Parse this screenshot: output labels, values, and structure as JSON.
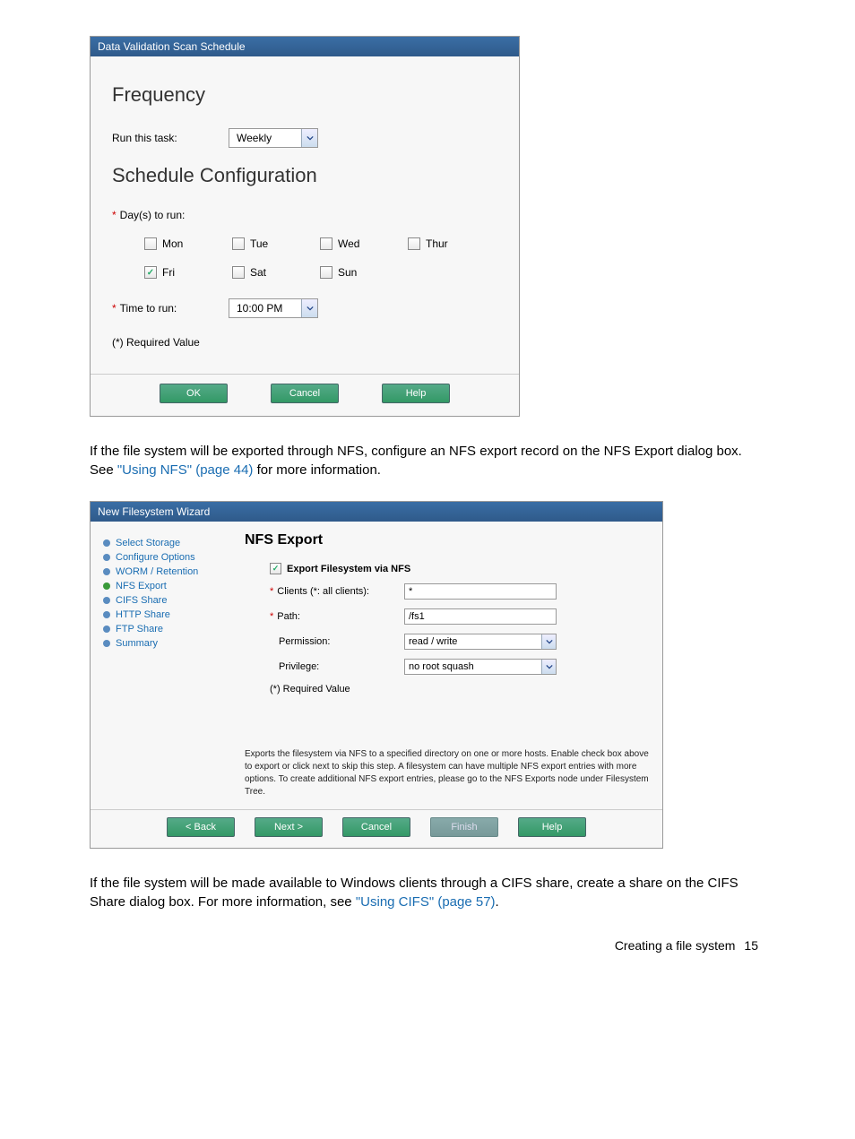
{
  "panel1": {
    "title": "Data Validation Scan Schedule",
    "section1": "Frequency",
    "task_label": "Run this task:",
    "task_value": "Weekly",
    "section2": "Schedule Configuration",
    "days_label": "Day(s) to run:",
    "days": {
      "mon": "Mon",
      "tue": "Tue",
      "wed": "Wed",
      "thur": "Thur",
      "fri": "Fri",
      "sat": "Sat",
      "sun": "Sun"
    },
    "time_label": "Time to run:",
    "time_value": "10:00 PM",
    "reqnote": "(*) Required Value",
    "buttons": {
      "ok": "OK",
      "cancel": "Cancel",
      "help": "Help"
    }
  },
  "p1": {
    "pre": "If the file system will be exported through NFS, configure an NFS export record on the NFS Export dialog box. See ",
    "link": "\"Using NFS\" (page 44)",
    "post": " for more information."
  },
  "panel2": {
    "title": "New Filesystem Wizard",
    "nav": [
      "Select Storage",
      "Configure Options",
      "WORM / Retention",
      "NFS Export",
      "CIFS Share",
      "HTTP Share",
      "FTP Share",
      "Summary"
    ],
    "heading": "NFS Export",
    "checkbox_label": "Export Filesystem via NFS",
    "fields": {
      "clients_label": "Clients (*: all clients):",
      "clients_value": "*",
      "path_label": "Path:",
      "path_value": "/fs1",
      "perm_label": "Permission:",
      "perm_value": "read / write",
      "priv_label": "Privilege:",
      "priv_value": "no root squash"
    },
    "reqnote": "(*) Required Value",
    "help": "Exports the filesystem via NFS to a specified directory on one or more hosts. Enable check box above to export or click next to skip this step. A filesystem can have multiple NFS export entries with more options. To create additional NFS export entries, please go to the NFS Exports node under Filesystem Tree.",
    "buttons": {
      "back": "< Back",
      "next": "Next >",
      "cancel": "Cancel",
      "finish": "Finish",
      "help": "Help"
    }
  },
  "p2": {
    "pre": "If the file system will be made available to Windows clients through a CIFS share, create a share on the CIFS Share dialog box. For more information, see ",
    "link": "\"Using CIFS\" (page 57)",
    "post": "."
  },
  "footer": {
    "label": "Creating a file system",
    "page": "15"
  }
}
